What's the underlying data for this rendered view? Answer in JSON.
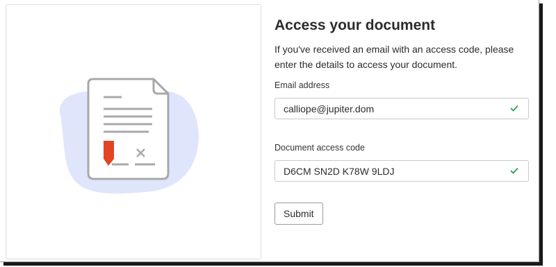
{
  "dialog": {
    "title": "Access your document",
    "description": "If you've received an email with an access code, please enter the details to access your document.",
    "email": {
      "label": "Email address",
      "value": "calliope@jupiter.dom",
      "valid": true
    },
    "access_code": {
      "label": "Document access code",
      "value": "D6CM SN2D K78W 9LDJ",
      "valid": true
    },
    "submit_label": "Submit"
  },
  "colors": {
    "accent_red": "#e34524",
    "blob_blue": "#dfe6fb",
    "check_green": "#2d9d4a",
    "doc_gray": "#a8a8a8"
  },
  "icons": {
    "illustration": "document-with-signature-icon",
    "valid": "checkmark-icon"
  }
}
